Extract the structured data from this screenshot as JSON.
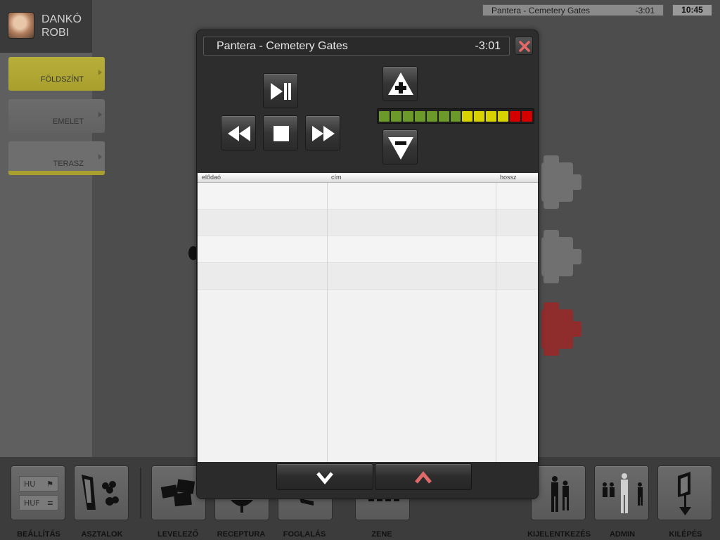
{
  "user": {
    "first_name": "DANKÓ",
    "last_name": "ROBI"
  },
  "floors": [
    {
      "label": "FÖLDSZÍNT",
      "state": "active"
    },
    {
      "label": "EMELET",
      "state": "inactive"
    },
    {
      "label": "TERASZ",
      "state": "inactive"
    }
  ],
  "status_bar": {
    "track": "Pantera - Cemetery Gates",
    "remaining": "-3:01",
    "clock": "10:45"
  },
  "player": {
    "track_title": "Pantera - Cemetery Gates",
    "remaining": "-3:01",
    "buttons": {
      "play_pause": "play-pause-icon",
      "rewind": "rewind-icon",
      "stop": "stop-icon",
      "forward": "fast-forward-icon",
      "volume_up": "volume-up-icon",
      "volume_down": "volume-down-icon",
      "close": "close-icon"
    },
    "volume": {
      "segments_total": 13,
      "colors": [
        "#6c9a2a",
        "#6c9a2a",
        "#6c9a2a",
        "#6c9a2a",
        "#6c9a2a",
        "#6c9a2a",
        "#6c9a2a",
        "#d8d200",
        "#d8d200",
        "#d8d200",
        "#d8d200",
        "#d40000",
        "#d40000"
      ]
    },
    "playlist": {
      "columns": [
        "elődaó",
        "cím",
        "hossz"
      ],
      "rows": [
        [
          "",
          "",
          ""
        ],
        [
          "",
          "",
          ""
        ],
        [
          "",
          "",
          ""
        ],
        [
          "",
          "",
          ""
        ]
      ]
    },
    "scroll": {
      "down": "chevron-down-icon",
      "up": "chevron-up-icon",
      "up_color": "#e06a6a"
    }
  },
  "settings": {
    "language": "HU",
    "currency": "HUF"
  },
  "toolbar": {
    "items": [
      {
        "label": "BEÁLLÍTÁS",
        "icon": "settings-icon"
      },
      {
        "label": "ASZTALOK",
        "icon": "tables-icon"
      },
      {
        "label": "LEVELEZŐ",
        "icon": "mail-icon"
      },
      {
        "label": "RECEPTURA",
        "icon": "recipe-icon"
      },
      {
        "label": "FOGLALÁS",
        "icon": "booking-icon"
      },
      {
        "label": "ZENE",
        "icon": "music-icon"
      },
      {
        "label": "KIJELENTKEZÉS",
        "icon": "logout-icon"
      },
      {
        "label": "ADMIN",
        "icon": "admin-icon"
      },
      {
        "label": "KILÉPÉS",
        "icon": "exit-icon"
      }
    ]
  },
  "colors": {
    "active_floor": "#b8ae3a",
    "table_alert": "#8f2c2c",
    "close_x": "#e46a6a"
  }
}
